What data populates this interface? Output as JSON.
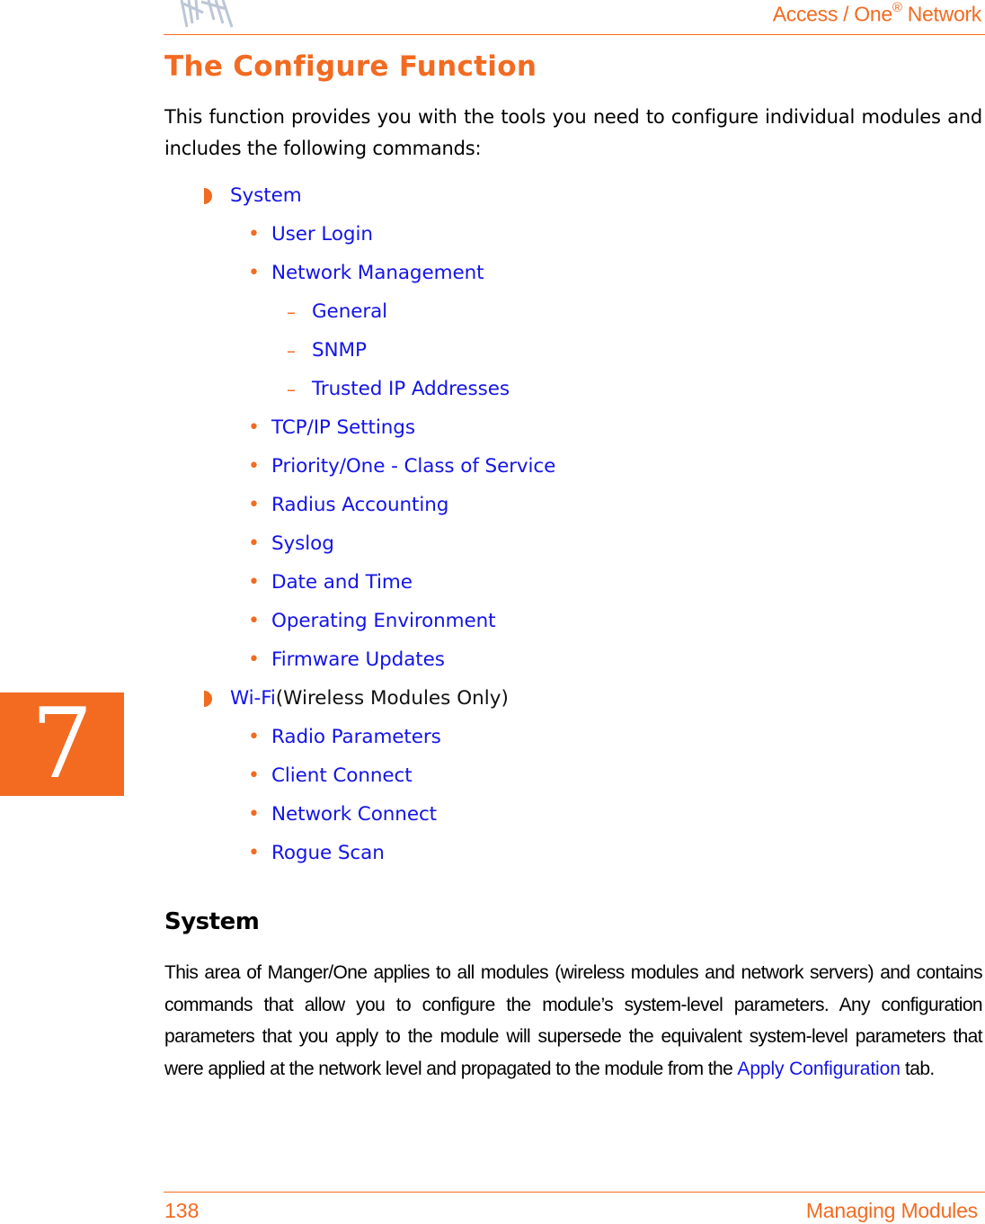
{
  "header": {
    "logo_icon": "wing-fan-logo",
    "title_main": "Access / One",
    "title_mark": "®",
    "title_suffix": " Network"
  },
  "chapter_tab": {
    "number": "7"
  },
  "page_title": "The Configure Function",
  "intro": "This function provides you with the tools you need to configure individual modules and includes the following commands:",
  "commands": [
    {
      "level": 1,
      "marker": "half-circle",
      "label": "System",
      "suffix": ""
    },
    {
      "level": 2,
      "marker": "•",
      "label": "User Login"
    },
    {
      "level": 2,
      "marker": "•",
      "label": "Network Management"
    },
    {
      "level": 3,
      "marker": "–",
      "label": "General"
    },
    {
      "level": 3,
      "marker": "–",
      "label": "SNMP"
    },
    {
      "level": 3,
      "marker": "–",
      "label": "Trusted IP Addresses"
    },
    {
      "level": 2,
      "marker": "•",
      "label": "TCP/IP Settings"
    },
    {
      "level": 2,
      "marker": "•",
      "label": "Priority/One - Class of Service"
    },
    {
      "level": 2,
      "marker": "•",
      "label": "Radius Accounting"
    },
    {
      "level": 2,
      "marker": "•",
      "label": "Syslog"
    },
    {
      "level": 2,
      "marker": "•",
      "label": "Date and Time"
    },
    {
      "level": 2,
      "marker": "•",
      "label": "Operating Environment"
    },
    {
      "level": 2,
      "marker": "•",
      "label": "Firmware Updates"
    },
    {
      "level": 1,
      "marker": "half-circle",
      "label": "Wi-Fi",
      "suffix": " (Wireless Modules Only)"
    },
    {
      "level": 2,
      "marker": "•",
      "label": "Radio Parameters"
    },
    {
      "level": 2,
      "marker": "•",
      "label": "Client Connect"
    },
    {
      "level": 2,
      "marker": "•",
      "label": "Network Connect"
    },
    {
      "level": 2,
      "marker": "•",
      "label": "Rogue Scan"
    }
  ],
  "section": {
    "heading": "System",
    "body_before_link": "This area of Manger/One applies to all modules (wireless modules and network servers) and contains commands that allow you to configure the module’s system-level parameters. Any configuration parameters that you apply to the module will supersede the equivalent system-level parameters that were applied at the network level and propagated to the module from the ",
    "link_text": "Apply Configuration",
    "body_after_link": " tab."
  },
  "footer": {
    "page_number": "138",
    "chapter_name": "Managing Modules"
  },
  "colors": {
    "accent_orange": "#f26b21",
    "link_blue": "#1414e6",
    "logo_gray": "#b8c4d4"
  }
}
